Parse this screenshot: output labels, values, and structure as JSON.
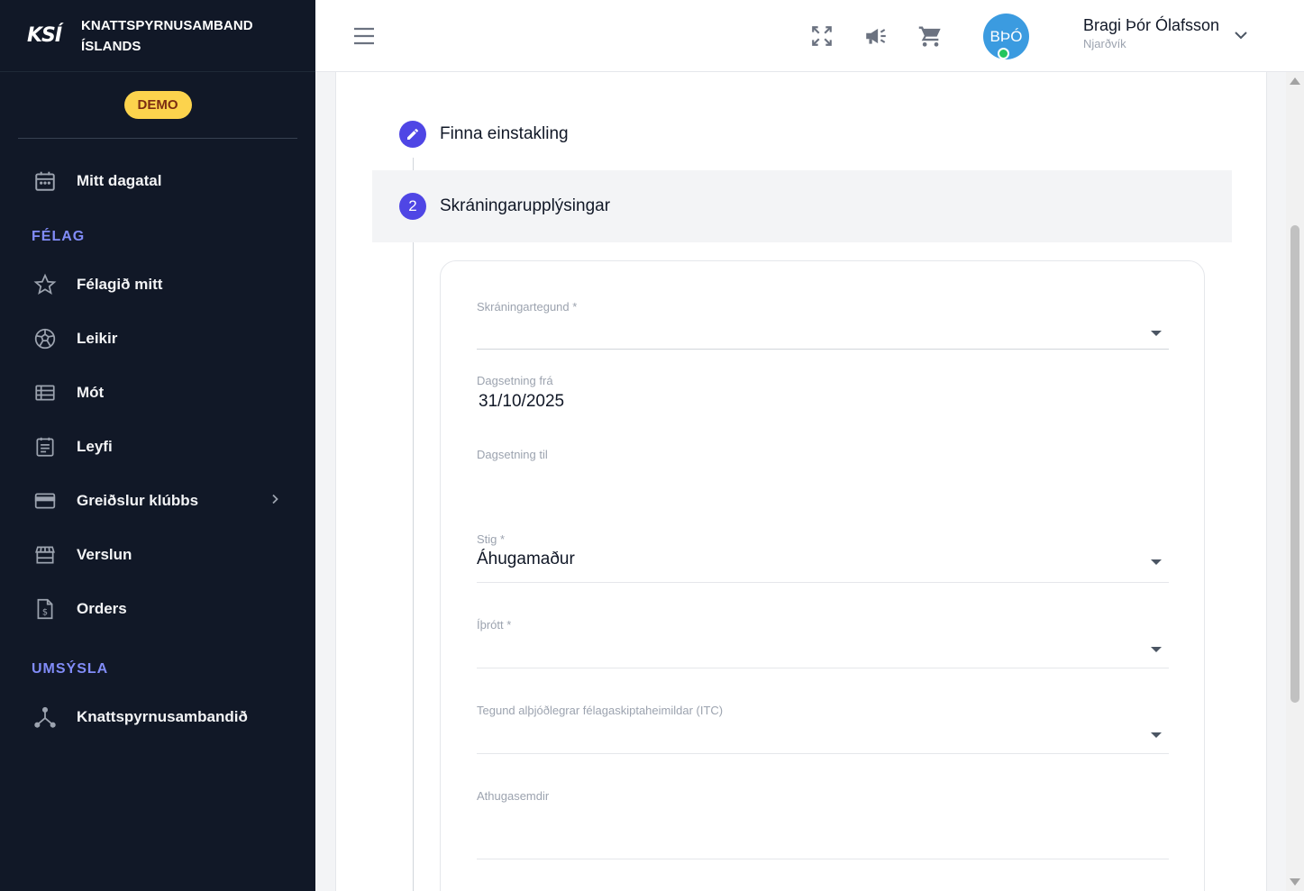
{
  "brand": {
    "logo": "KSÍ",
    "name_line1": "KNATTSPYRNUSAMBAND",
    "name_line2": "ÍSLANDS"
  },
  "demo_badge": "DEMO",
  "sidebar": {
    "top_items": [
      {
        "label": "Mitt dagatal",
        "icon": "calendar-icon"
      }
    ],
    "section_felag": "FÉLAG",
    "felag_items": [
      {
        "label": "Félagið mitt",
        "icon": "star-icon"
      },
      {
        "label": "Leikir",
        "icon": "soccer-ball-icon"
      },
      {
        "label": "Mót",
        "icon": "list-icon"
      },
      {
        "label": "Leyfi",
        "icon": "document-icon"
      },
      {
        "label": "Greiðslur klúbbs",
        "icon": "credit-card-icon"
      },
      {
        "label": "Verslun",
        "icon": "store-icon"
      },
      {
        "label": "Orders",
        "icon": "invoice-icon"
      }
    ],
    "section_umsysla": "UMSÝSLA",
    "umsysla_items": [
      {
        "label": "Knattspyrnusambandið",
        "icon": "network-icon"
      }
    ]
  },
  "header": {
    "avatar_initials": "BÞÓ",
    "user_name": "Bragi Þór Ólafsson",
    "user_club": "Njarðvík"
  },
  "steps": [
    {
      "number": "",
      "label": "Finna einstakling",
      "icon": "pencil-icon"
    },
    {
      "number": "2",
      "label": "Skráningarupplýsingar"
    }
  ],
  "form": {
    "registration_type": {
      "label": "Skráningartegund *",
      "value": ""
    },
    "date_from": {
      "label": "Dagsetning frá",
      "value": "31/10/2025"
    },
    "date_to": {
      "label": "Dagsetning til",
      "value": ""
    },
    "level": {
      "label": "Stig *",
      "value": "Áhugamaður"
    },
    "sport": {
      "label": "Íþrótt *",
      "value": ""
    },
    "itc_type": {
      "label": "Tegund alþjóðlegrar félagaskiptaheimildar (ITC)",
      "value": ""
    },
    "remarks": {
      "label": "Athugasemdir",
      "value": ""
    }
  },
  "colors": {
    "sidebar_bg": "#111827",
    "accent": "#4f46e5",
    "section_title": "#818cf8",
    "demo": "#fcd34d",
    "avatar": "#3b9be0",
    "online": "#22c55e"
  }
}
